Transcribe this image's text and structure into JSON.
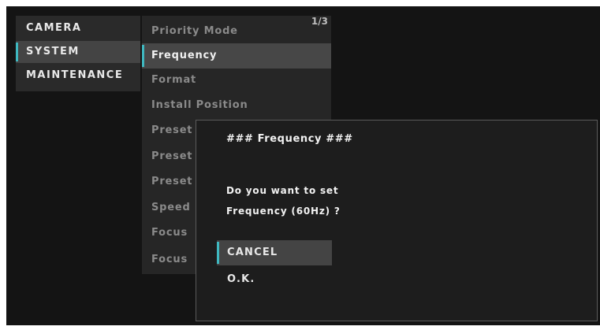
{
  "main_menu": {
    "items": [
      {
        "label": "CAMERA"
      },
      {
        "label": "SYSTEM"
      },
      {
        "label": "MAINTENANCE"
      }
    ],
    "selected": "SYSTEM"
  },
  "sub_menu": {
    "page_indicator": "1/3",
    "items": [
      {
        "label": "Priority Mode"
      },
      {
        "label": "Frequency"
      },
      {
        "label": "Format"
      },
      {
        "label": "Install Position"
      },
      {
        "label": "Preset"
      },
      {
        "label": "Preset"
      },
      {
        "label": "Preset"
      },
      {
        "label": "Speed"
      },
      {
        "label": "Focus"
      },
      {
        "label": "Focus"
      }
    ],
    "selected": "Frequency"
  },
  "dialog": {
    "title": "### Frequency ###",
    "message_line1": "Do you want to set",
    "message_line2": "Frequency (60Hz) ?",
    "cancel_label": "CANCEL",
    "ok_label": "O.K.",
    "selected": "CANCEL"
  },
  "colors": {
    "background": "#141414",
    "menu_bg": "#2a2a2a",
    "selected_bg": "#444444",
    "accent": "#3fb8c0",
    "text": "#e8e8e8",
    "dim_text": "#8a8a8a"
  }
}
